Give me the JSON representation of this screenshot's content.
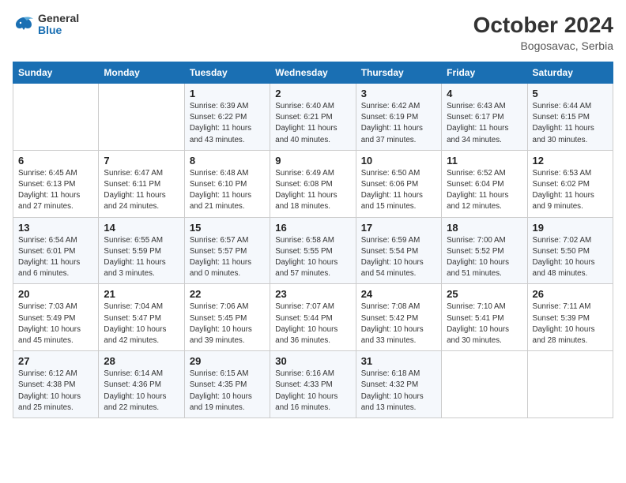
{
  "header": {
    "logo_line1": "General",
    "logo_line2": "Blue",
    "month_year": "October 2024",
    "location": "Bogosavac, Serbia"
  },
  "days_of_week": [
    "Sunday",
    "Monday",
    "Tuesday",
    "Wednesday",
    "Thursday",
    "Friday",
    "Saturday"
  ],
  "weeks": [
    [
      {
        "num": "",
        "detail": ""
      },
      {
        "num": "",
        "detail": ""
      },
      {
        "num": "1",
        "detail": "Sunrise: 6:39 AM\nSunset: 6:22 PM\nDaylight: 11 hours\nand 43 minutes."
      },
      {
        "num": "2",
        "detail": "Sunrise: 6:40 AM\nSunset: 6:21 PM\nDaylight: 11 hours\nand 40 minutes."
      },
      {
        "num": "3",
        "detail": "Sunrise: 6:42 AM\nSunset: 6:19 PM\nDaylight: 11 hours\nand 37 minutes."
      },
      {
        "num": "4",
        "detail": "Sunrise: 6:43 AM\nSunset: 6:17 PM\nDaylight: 11 hours\nand 34 minutes."
      },
      {
        "num": "5",
        "detail": "Sunrise: 6:44 AM\nSunset: 6:15 PM\nDaylight: 11 hours\nand 30 minutes."
      }
    ],
    [
      {
        "num": "6",
        "detail": "Sunrise: 6:45 AM\nSunset: 6:13 PM\nDaylight: 11 hours\nand 27 minutes."
      },
      {
        "num": "7",
        "detail": "Sunrise: 6:47 AM\nSunset: 6:11 PM\nDaylight: 11 hours\nand 24 minutes."
      },
      {
        "num": "8",
        "detail": "Sunrise: 6:48 AM\nSunset: 6:10 PM\nDaylight: 11 hours\nand 21 minutes."
      },
      {
        "num": "9",
        "detail": "Sunrise: 6:49 AM\nSunset: 6:08 PM\nDaylight: 11 hours\nand 18 minutes."
      },
      {
        "num": "10",
        "detail": "Sunrise: 6:50 AM\nSunset: 6:06 PM\nDaylight: 11 hours\nand 15 minutes."
      },
      {
        "num": "11",
        "detail": "Sunrise: 6:52 AM\nSunset: 6:04 PM\nDaylight: 11 hours\nand 12 minutes."
      },
      {
        "num": "12",
        "detail": "Sunrise: 6:53 AM\nSunset: 6:02 PM\nDaylight: 11 hours\nand 9 minutes."
      }
    ],
    [
      {
        "num": "13",
        "detail": "Sunrise: 6:54 AM\nSunset: 6:01 PM\nDaylight: 11 hours\nand 6 minutes."
      },
      {
        "num": "14",
        "detail": "Sunrise: 6:55 AM\nSunset: 5:59 PM\nDaylight: 11 hours\nand 3 minutes."
      },
      {
        "num": "15",
        "detail": "Sunrise: 6:57 AM\nSunset: 5:57 PM\nDaylight: 11 hours\nand 0 minutes."
      },
      {
        "num": "16",
        "detail": "Sunrise: 6:58 AM\nSunset: 5:55 PM\nDaylight: 10 hours\nand 57 minutes."
      },
      {
        "num": "17",
        "detail": "Sunrise: 6:59 AM\nSunset: 5:54 PM\nDaylight: 10 hours\nand 54 minutes."
      },
      {
        "num": "18",
        "detail": "Sunrise: 7:00 AM\nSunset: 5:52 PM\nDaylight: 10 hours\nand 51 minutes."
      },
      {
        "num": "19",
        "detail": "Sunrise: 7:02 AM\nSunset: 5:50 PM\nDaylight: 10 hours\nand 48 minutes."
      }
    ],
    [
      {
        "num": "20",
        "detail": "Sunrise: 7:03 AM\nSunset: 5:49 PM\nDaylight: 10 hours\nand 45 minutes."
      },
      {
        "num": "21",
        "detail": "Sunrise: 7:04 AM\nSunset: 5:47 PM\nDaylight: 10 hours\nand 42 minutes."
      },
      {
        "num": "22",
        "detail": "Sunrise: 7:06 AM\nSunset: 5:45 PM\nDaylight: 10 hours\nand 39 minutes."
      },
      {
        "num": "23",
        "detail": "Sunrise: 7:07 AM\nSunset: 5:44 PM\nDaylight: 10 hours\nand 36 minutes."
      },
      {
        "num": "24",
        "detail": "Sunrise: 7:08 AM\nSunset: 5:42 PM\nDaylight: 10 hours\nand 33 minutes."
      },
      {
        "num": "25",
        "detail": "Sunrise: 7:10 AM\nSunset: 5:41 PM\nDaylight: 10 hours\nand 30 minutes."
      },
      {
        "num": "26",
        "detail": "Sunrise: 7:11 AM\nSunset: 5:39 PM\nDaylight: 10 hours\nand 28 minutes."
      }
    ],
    [
      {
        "num": "27",
        "detail": "Sunrise: 6:12 AM\nSunset: 4:38 PM\nDaylight: 10 hours\nand 25 minutes."
      },
      {
        "num": "28",
        "detail": "Sunrise: 6:14 AM\nSunset: 4:36 PM\nDaylight: 10 hours\nand 22 minutes."
      },
      {
        "num": "29",
        "detail": "Sunrise: 6:15 AM\nSunset: 4:35 PM\nDaylight: 10 hours\nand 19 minutes."
      },
      {
        "num": "30",
        "detail": "Sunrise: 6:16 AM\nSunset: 4:33 PM\nDaylight: 10 hours\nand 16 minutes."
      },
      {
        "num": "31",
        "detail": "Sunrise: 6:18 AM\nSunset: 4:32 PM\nDaylight: 10 hours\nand 13 minutes."
      },
      {
        "num": "",
        "detail": ""
      },
      {
        "num": "",
        "detail": ""
      }
    ]
  ]
}
